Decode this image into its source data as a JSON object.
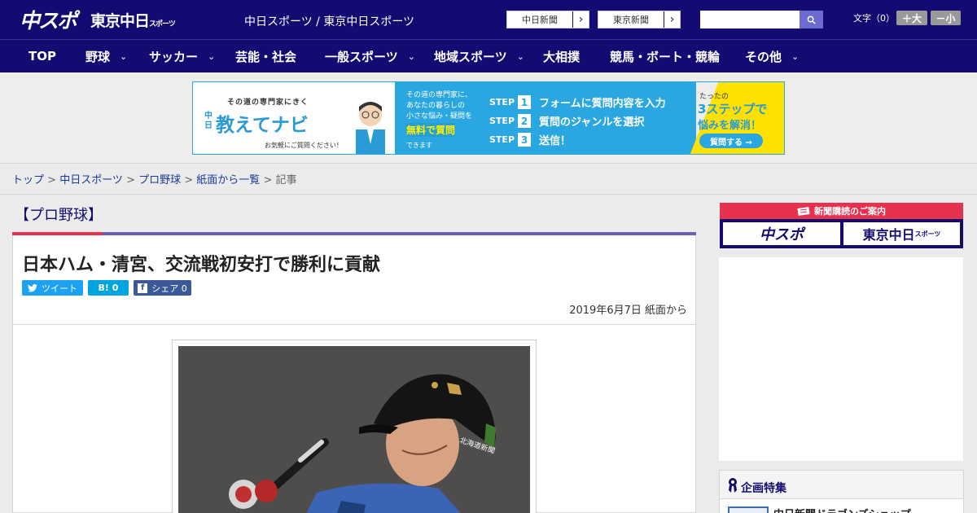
{
  "header": {
    "logo_chuspo": "中スポ",
    "logo_tokyo": "東京中日",
    "logo_tokyo_small": "スポーツ",
    "site_names": "中日スポーツ / 東京中日スポーツ",
    "paper_links": [
      {
        "label": "中日新聞"
      },
      {
        "label": "東京新聞"
      }
    ],
    "search_placeholder": "",
    "font_size_label": "文字（0）",
    "font_larger": "＋大",
    "font_smaller": "－小"
  },
  "nav": {
    "items": [
      {
        "label": "TOP",
        "dropdown": false
      },
      {
        "label": "野球",
        "dropdown": true
      },
      {
        "label": "サッカー",
        "dropdown": true
      },
      {
        "label": "芸能・社会",
        "dropdown": false
      },
      {
        "label": "一般スポーツ",
        "dropdown": true
      },
      {
        "label": "地域スポーツ",
        "dropdown": true
      },
      {
        "label": "大相撲",
        "dropdown": false
      },
      {
        "label": "競馬・ボート・競輪",
        "dropdown": false
      },
      {
        "label": "その他",
        "dropdown": true
      }
    ]
  },
  "banner": {
    "subtitle": "その道の専門家にきく",
    "chu": "中日",
    "title": "教えてナビ",
    "note": "お気軽にご質問ください！",
    "mid_text_1": "その道の専門家に、",
    "mid_text_2": "あなたの暮らしの",
    "mid_text_3": "小さな悩み・疑問を",
    "mid_free": "無料で質問",
    "mid_can": "できます",
    "steps": [
      {
        "step": "STEP",
        "num": "1",
        "text": "フォームに質問内容を入力"
      },
      {
        "step": "STEP",
        "num": "2",
        "text": "質問のジャンルを選択"
      },
      {
        "step": "STEP",
        "num": "3",
        "text": "送信！"
      }
    ],
    "right_1": "たったの",
    "right_2": "3ステップで",
    "right_3": "悩みを解消！",
    "right_btn": "質問する →"
  },
  "breadcrumb": {
    "items": [
      "トップ",
      "中日スポーツ",
      "プロ野球",
      "紙面から一覧"
    ],
    "current": "記事",
    "sep": " > "
  },
  "article": {
    "category": "【プロ野球】",
    "headline": "日本ハム・清宮、交流戦初安打で勝利に貢献",
    "tweet": "ツイート",
    "hatena": "B! 0",
    "share": "シェア 0",
    "date": "2019年6月7日 紙面から",
    "helmet_text": "北海道新聞"
  },
  "sidebar": {
    "subscription_head": "新聞購読のご案内",
    "sub_chuspo": "中スポ",
    "sub_tokyo": "東京中日",
    "sub_tokyo_small": "スポーツ",
    "feature_title": "企画特集",
    "feature_item": "中日新聞ドラゴンズショップ"
  },
  "colors": {
    "brand_navy": "#140b72",
    "accent_red": "#e8304f",
    "accent_purple": "#6c5cb7",
    "twitter": "#1da1f2",
    "hatena": "#00a4de",
    "facebook": "#3b5998"
  }
}
